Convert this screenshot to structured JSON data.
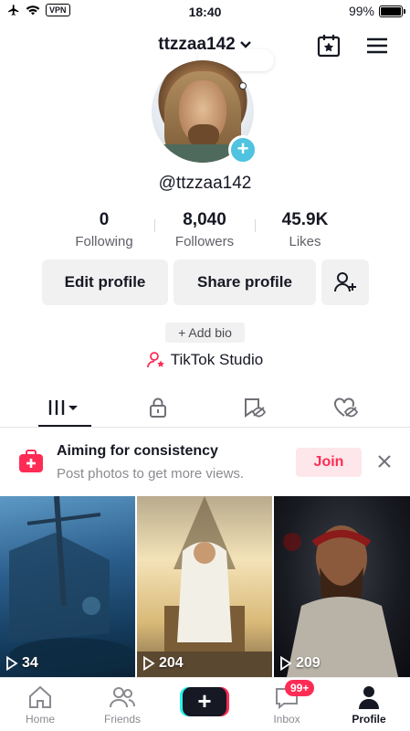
{
  "status_bar": {
    "vpn": "VPN",
    "time": "18:40",
    "battery_text": "99%",
    "battery_level": 0.99
  },
  "header": {
    "username": "ttzzaa142",
    "chevron_icon": "chevron-down-icon",
    "calendar_icon": "calendar-star-icon",
    "menu_icon": "hamburger-menu-icon"
  },
  "profile": {
    "handle": "@ttzzaa142",
    "add_avatar_symbol": "+"
  },
  "stats": [
    {
      "value": "0",
      "label": "Following"
    },
    {
      "value": "8,040",
      "label": "Followers"
    },
    {
      "value": "45.9K",
      "label": "Likes"
    }
  ],
  "actions": {
    "edit_label": "Edit profile",
    "share_label": "Share profile",
    "add_friend_icon": "add-user-icon"
  },
  "bio": {
    "add_label": "+ Add bio"
  },
  "studio": {
    "label": "TikTok Studio",
    "icon": "person-star-icon"
  },
  "tabs": [
    {
      "icon": "grid-videos-icon",
      "selected": true
    },
    {
      "icon": "lock-icon",
      "selected": false
    },
    {
      "icon": "bookmark-eye-icon",
      "selected": false
    },
    {
      "icon": "heart-eye-icon",
      "selected": false
    }
  ],
  "banner": {
    "title": "Aiming for consistency",
    "subtitle": "Post photos to get more views.",
    "join_label": "Join",
    "accent": "#fe2c55"
  },
  "videos": [
    {
      "views": "34"
    },
    {
      "views": "204"
    },
    {
      "views": "209"
    }
  ],
  "nav": {
    "items": [
      {
        "label": "Home",
        "icon": "home-icon"
      },
      {
        "label": "Friends",
        "icon": "friends-icon"
      },
      {
        "label": "Inbox",
        "icon": "inbox-icon"
      },
      {
        "label": "Profile",
        "icon": "profile-icon"
      }
    ],
    "create_symbol": "+",
    "inbox_badge": "99+"
  }
}
